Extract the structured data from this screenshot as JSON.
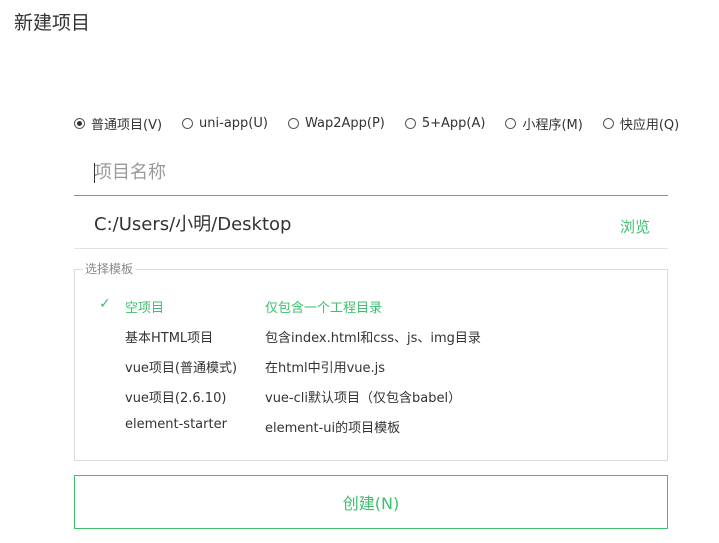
{
  "window": {
    "title": "新建项目"
  },
  "project_types": {
    "selected_index": 0,
    "items": [
      {
        "label": "普通项目(V)"
      },
      {
        "label": "uni-app(U)"
      },
      {
        "label": "Wap2App(P)"
      },
      {
        "label": "5+App(A)"
      },
      {
        "label": "小程序(M)"
      },
      {
        "label": "快应用(Q)"
      }
    ]
  },
  "project_name": {
    "value": "",
    "placeholder": "项目名称"
  },
  "location": {
    "path": "C:/Users/小明/Desktop",
    "browse_label": "浏览"
  },
  "templates": {
    "legend": "选择模板",
    "check_glyph": "✓",
    "items": [
      {
        "name": "空项目",
        "description": "仅包含一个工程目录",
        "selected": true
      },
      {
        "name": "基本HTML项目",
        "description": "包含index.html和css、js、img目录",
        "selected": false
      },
      {
        "name": "vue项目(普通模式)",
        "description": "在html中引用vue.js",
        "selected": false
      },
      {
        "name": "vue项目(2.6.10)",
        "description": "vue-cli默认项目（仅包含babel）",
        "selected": false
      },
      {
        "name": "element-starter",
        "description": "element-ui的项目模板",
        "selected": false
      }
    ]
  },
  "actions": {
    "create_label": "创建(N)"
  },
  "colors": {
    "accent": "#3dbf6e",
    "text": "#333333",
    "placeholder": "#9a9a9a",
    "border": "#dcdcdc"
  }
}
